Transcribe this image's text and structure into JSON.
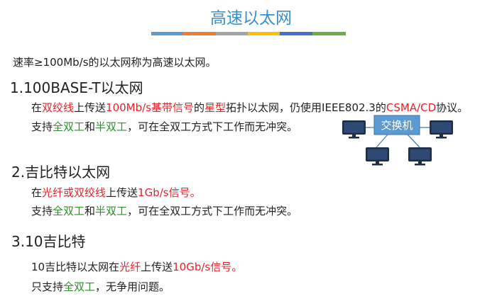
{
  "title": "高速以太网",
  "color_bars": [
    "#5b9bd5",
    "#ed7d31",
    "#a5a5a5",
    "#ffc000",
    "#4472c4",
    "#70ad47"
  ],
  "intro": "速率≥100Mb/s的以太网称为高速以太网。",
  "sections": [
    {
      "heading": "1.100BASE-T以太网",
      "line1": {
        "p1": "在",
        "p2": "双绞线",
        "p3": "上传送",
        "p4": "100Mb/s基带信号",
        "p5": "的",
        "p6": "星型",
        "p7": "拓扑以太网，仍使用IEEE802.3的",
        "p8": "CSMA/CD",
        "p9": "协议。"
      },
      "line2": {
        "p1": "支持",
        "p2": "全双工",
        "p3": "和",
        "p4": "半双工",
        "p5": "，可在全双工方式下工作而无冲突。"
      }
    },
    {
      "heading": "2.吉比特以太网",
      "line1": {
        "p1": "在",
        "p2": "光纤或双绞线",
        "p3": "上传送",
        "p4": "1Gb/s信号。"
      },
      "line2": {
        "p1": "支持",
        "p2": "全双工",
        "p3": "和",
        "p4": "半双工",
        "p5": "，可在全双工方式下工作而无冲突。"
      }
    },
    {
      "heading": "3.10吉比特",
      "line1": {
        "p1": "10吉比特以太网在",
        "p2": "光纤",
        "p3": "上传送",
        "p4": "10Gb/s信号。"
      },
      "line2": {
        "p1": "只支持",
        "p2": "全双工",
        "p3": "，无争用问题。"
      }
    }
  ],
  "diagram": {
    "switch_label": "交换机",
    "computer_icon": "monitor-icon",
    "switch_color": "#5b9bd5"
  }
}
